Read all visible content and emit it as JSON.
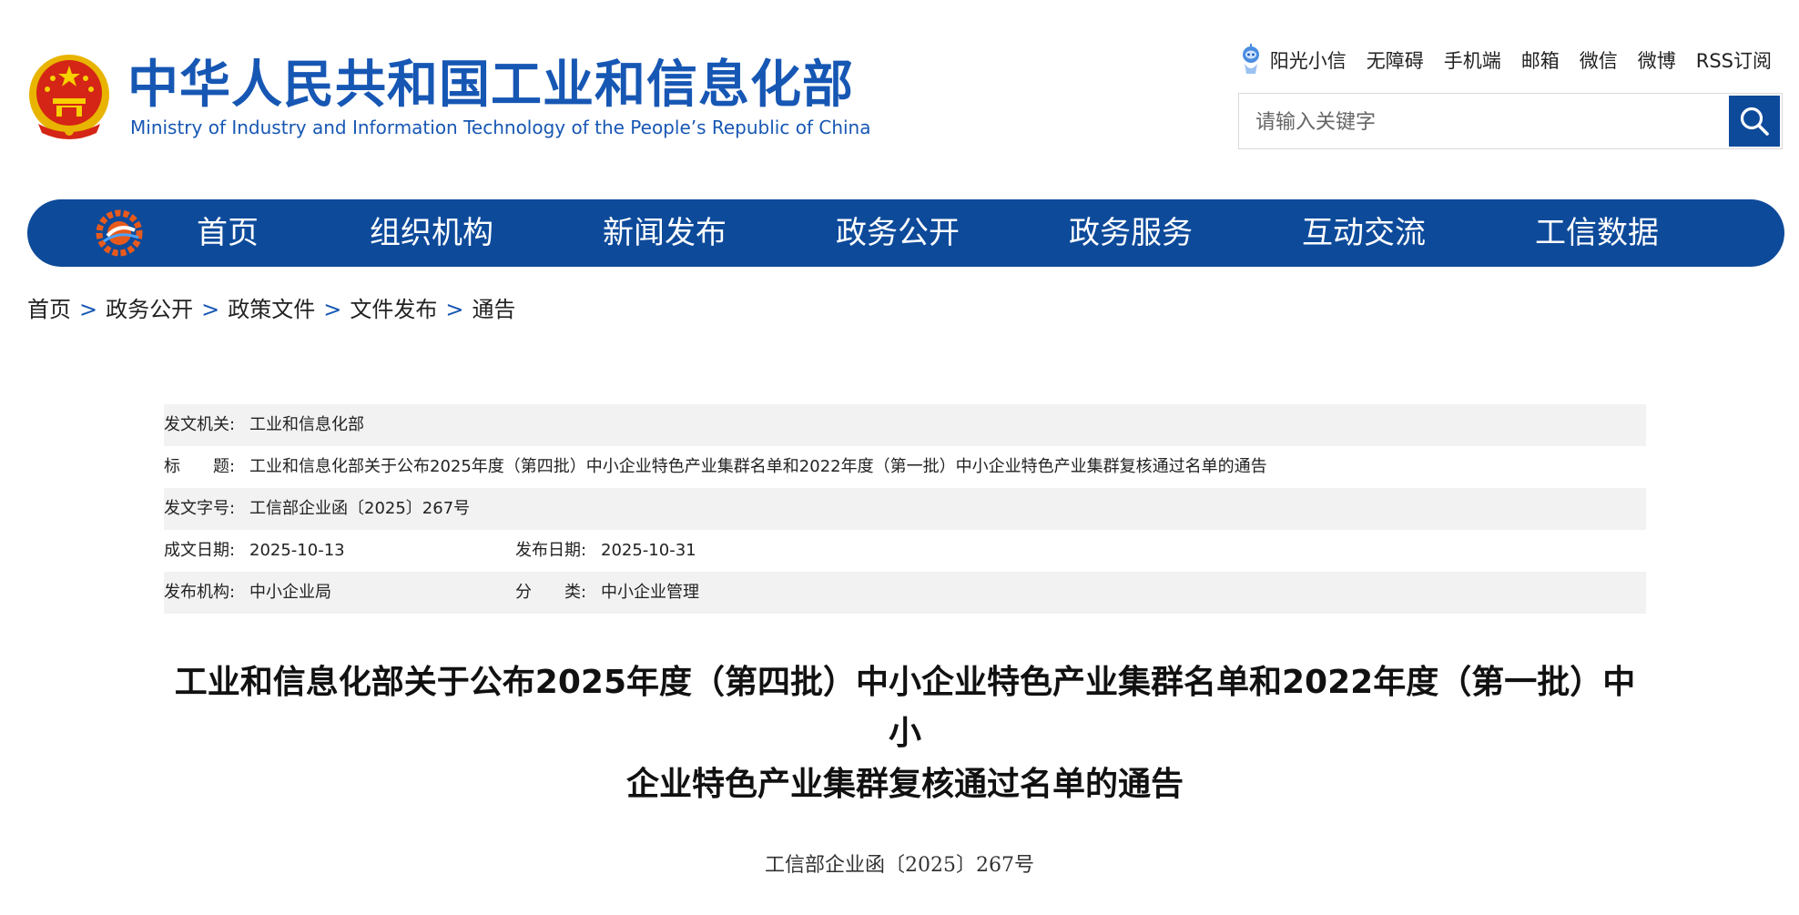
{
  "header": {
    "title_cn": "中华人民共和国工业和信息化部",
    "title_en": "Ministry of Industry and Information Technology of the People’s Republic of China"
  },
  "toplinks": [
    {
      "label": "阳光小信",
      "icon": "robot-icon"
    },
    {
      "label": "无障碍"
    },
    {
      "label": "手机端"
    },
    {
      "label": "邮箱"
    },
    {
      "label": "微信"
    },
    {
      "label": "微博"
    },
    {
      "label": "RSS订阅"
    }
  ],
  "search": {
    "placeholder": "请输入关键字",
    "icon": "search-icon"
  },
  "nav": {
    "items": [
      "首页",
      "组织机构",
      "新闻发布",
      "政务公开",
      "政务服务",
      "互动交流",
      "工信数据"
    ],
    "color": "#0d4a9a"
  },
  "breadcrumb": {
    "items": [
      "首页",
      "政务公开",
      "政策文件",
      "文件发布",
      "通告"
    ],
    "separator": ">"
  },
  "meta": {
    "issuer_label": "发文机关:",
    "issuer": "工业和信息化部",
    "title_label": "标　　题:",
    "title": "工业和信息化部关于公布2025年度（第四批）中小企业特色产业集群名单和2022年度（第一批）中小企业特色产业集群复核通过名单的通告",
    "docno_label": "发文字号:",
    "docno": "工信部企业函〔2025〕267号",
    "written_label": "成文日期:",
    "written": "2025-10-13",
    "published_label": "发布日期:",
    "published": "2025-10-31",
    "org_label": "发布机构:",
    "org": "中小企业局",
    "category_label": "分　　类:",
    "category": "中小企业管理"
  },
  "article": {
    "title_line1": "工业和信息化部关于公布2025年度（第四批）中小企业特色产业集群名单和2022年度（第一批）中小",
    "title_line2": "企业特色产业集群复核通过名单的通告",
    "docno": "工信部企业函〔2025〕267号"
  },
  "colors": {
    "brand_blue": "#1757b4",
    "nav_blue": "#0d4a9a",
    "meta_shade": "#f2f2f2"
  }
}
